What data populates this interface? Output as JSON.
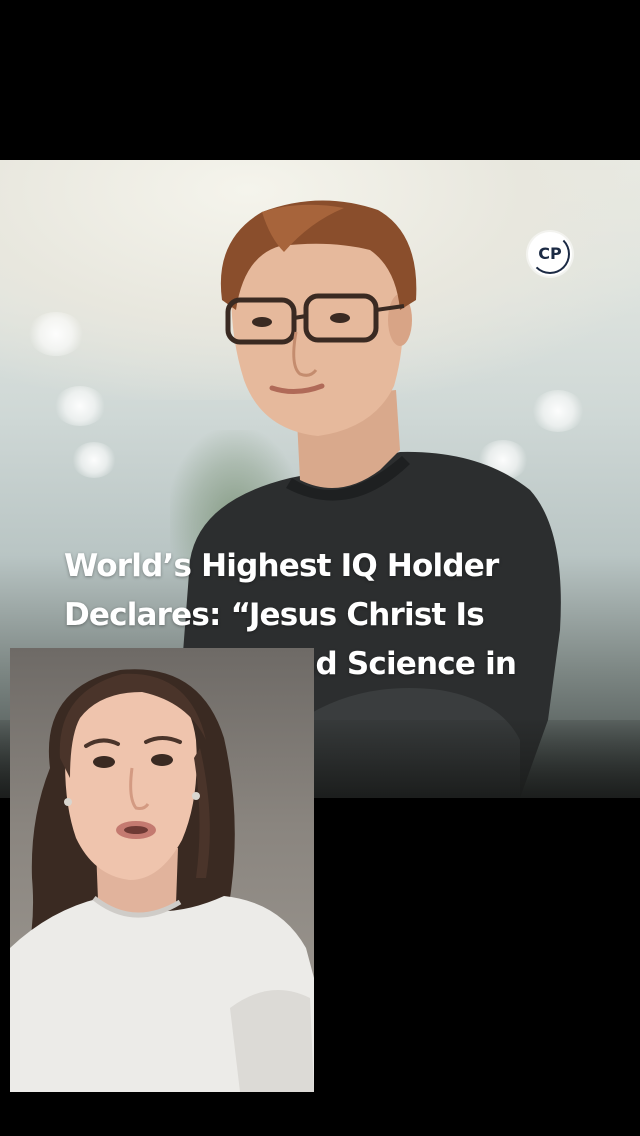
{
  "article": {
    "logo_text": "CP",
    "headline": "World’s Highest IQ Holder Declares: “Jesus Christ Is God”—Faith and Science in Harmony"
  },
  "colors": {
    "background": "#000000",
    "headline_text": "#ffffff",
    "logo_text": "#1b2a44"
  },
  "icons": {
    "logo": "cp-logo-icon"
  }
}
